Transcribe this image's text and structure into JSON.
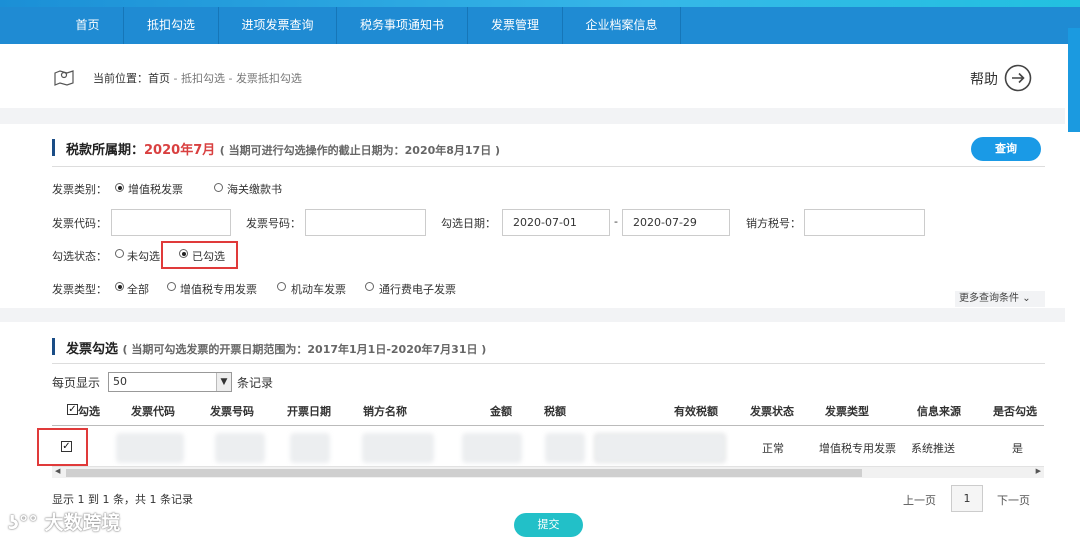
{
  "nav": {
    "items": [
      "首页",
      "抵扣勾选",
      "进项发票查询",
      "税务事项通知书",
      "发票管理",
      "企业档案信息"
    ]
  },
  "breadcrumb": {
    "prefix": "当前位置：",
    "home": "首页",
    "sep": " - ",
    "level1": "抵扣勾选",
    "level2": "发票抵扣勾选"
  },
  "help": {
    "label": "帮助"
  },
  "tax_period": {
    "title": "税款所属期：",
    "period": "2020年7月",
    "note": "( 当期可进行勾选操作的截止日期为：2020年8月17日 )",
    "query_button": "查询"
  },
  "filters": {
    "invoice_category_label": "发票类别：",
    "invoice_category_options": [
      "增值税发票",
      "海关缴款书"
    ],
    "invoice_code_label": "发票代码：",
    "invoice_code_value": "",
    "invoice_number_label": "发票号码：",
    "invoice_number_value": "",
    "select_date_label": "勾选日期：",
    "date_from": "2020-07-01",
    "date_sep": "-",
    "date_to": "2020-07-29",
    "seller_tax_label": "销方税号：",
    "seller_tax_value": "",
    "select_status_label": "勾选状态：",
    "select_status_options": [
      "未勾选",
      "已勾选"
    ],
    "invoice_type_label": "发票类型：",
    "invoice_type_options": [
      "全部",
      "增值税专用发票",
      "机动车发票",
      "通行费电子发票"
    ],
    "more_conditions": "更多查询条件"
  },
  "invoice_select": {
    "title": "发票勾选",
    "note": "( 当期可勾选发票的开票日期范围为：2017年1月1日-2020年7月31日 )",
    "per_page_label": "每页显示",
    "per_page_value": "50",
    "records_label": "条记录"
  },
  "table": {
    "headers": [
      "勾选",
      "发票代码",
      "发票号码",
      "开票日期",
      "销方名称",
      "金额",
      "税额",
      "有效税额",
      "发票状态",
      "发票类型",
      "信息来源",
      "是否勾选"
    ],
    "rows": [
      {
        "checked": true,
        "status": "正常",
        "type": "增值税专用发票",
        "source": "系统推送",
        "selected": "是"
      }
    ]
  },
  "pagination": {
    "summary": "显示 1 到 1 条，共 1 条记录",
    "prev": "上一页",
    "page": "1",
    "next": "下一页"
  },
  "submit": {
    "label": "提交"
  },
  "watermark": {
    "text": "大数跨境"
  },
  "colors": {
    "nav": "#1f8bd3",
    "accent": "#1a9ae6",
    "period": "#d94040",
    "submit": "#22c0c8",
    "highlight": "#e03a3a"
  }
}
